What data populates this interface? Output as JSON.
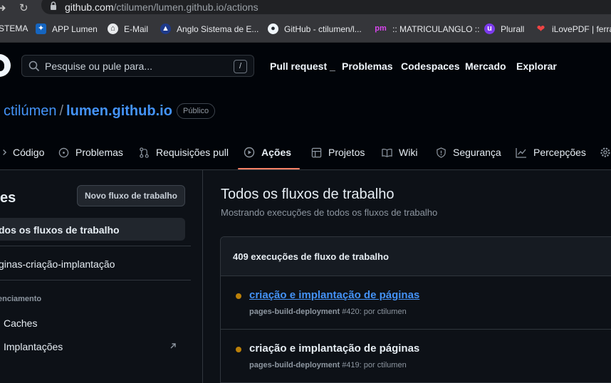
{
  "browser": {
    "url_host": "github.com",
    "url_path": "/ctilumen/lumen.github.io/actions",
    "bookmarks": [
      {
        "label": "STEMA",
        "icon": "none"
      },
      {
        "label": "APP Lumen",
        "icon": "star-app-icon"
      },
      {
        "label": "E-Mail",
        "icon": "home-mail-icon"
      },
      {
        "label": "Anglo Sistema de E...",
        "icon": "anglo-icon"
      },
      {
        "label": "GitHub - ctilumen/l...",
        "icon": "github-icon"
      },
      {
        "label": ":: MATRICULANGLO ::",
        "icon": "pm-icon"
      },
      {
        "label": "Plurall",
        "icon": "plurall-icon"
      },
      {
        "label": "iLovePDF | ferra",
        "icon": "heart-icon"
      }
    ]
  },
  "header": {
    "search_placeholder": "Pesquise ou pule para...",
    "search_shortcut": "/",
    "nav": [
      "Pull request _",
      "Problemas",
      "Codespaces",
      "Mercado",
      "Explorar"
    ]
  },
  "repo": {
    "owner": "ctilúmen",
    "separator": "/",
    "name": "lumen.github.io",
    "visibility": "Público",
    "tabs": [
      "Código",
      "Problemas",
      "Requisições pull",
      "Ações",
      "Projetos",
      "Wiki",
      "Segurança",
      "Percepções"
    ],
    "active_tab": "Ações"
  },
  "sidebar": {
    "title": "es",
    "new_workflow_button": "Novo fluxo de trabalho",
    "items": [
      "dos os fluxos de trabalho",
      "ginas-criação-implantação"
    ],
    "management_heading": "enciamento",
    "management_items": [
      "Caches",
      "Implantações"
    ]
  },
  "main": {
    "title": "Todos os fluxos de trabalho",
    "subtitle": "Mostrando execuções de todos os fluxos de trabalho",
    "runs_count": "409 execuções de fluxo de trabalho",
    "runs": [
      {
        "title": "criação e implantação de páginas",
        "workflow": "pages-build-deployment",
        "meta": "#420: por ctilumen"
      },
      {
        "title": "criação e implantação de páginas",
        "workflow": "pages-build-deployment",
        "meta": "#419: por ctilumen"
      }
    ]
  },
  "colors": {
    "accent_link": "#4493f8",
    "tab_underline": "#f78166",
    "status_pending": "#bb8009",
    "background": "#0d1117"
  }
}
